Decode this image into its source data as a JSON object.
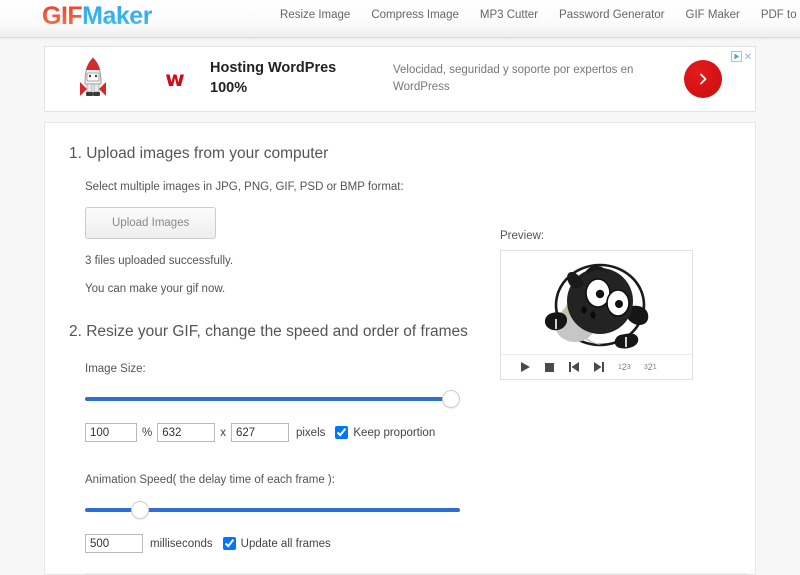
{
  "header": {
    "logo_gif": "GIF",
    "logo_maker": "Maker",
    "nav": [
      {
        "label": "Resize Image"
      },
      {
        "label": "Compress Image"
      },
      {
        "label": "MP3 Cutter"
      },
      {
        "label": "Password Generator"
      },
      {
        "label": "GIF Maker"
      },
      {
        "label": "PDF to JPG"
      }
    ]
  },
  "ad": {
    "brand_mark": "ᴡ",
    "headline": "Hosting WordPres 100%",
    "body": "Velocidad, seguridad y soporte por expertos en WordPress",
    "cta_icon": "chevron-right-icon",
    "adchoices_icon": "adchoices-triangle-icon",
    "close_label": "✕"
  },
  "step1": {
    "title": "1. Upload images from your computer",
    "instruction": "Select multiple images in JPG, PNG, GIF, PSD or BMP format:",
    "upload_button": "Upload Images",
    "status": "3 files uploaded successfully.",
    "hint": "You can make your gif now."
  },
  "step2": {
    "title": "2. Resize your GIF, change the speed and order of frames",
    "image_size_label": "Image Size:",
    "size_slider_percent": 100,
    "percent_value": "100",
    "percent_symbol": "%",
    "width_value": "632",
    "times_symbol": "x",
    "height_value": "627",
    "pixels_label": "pixels",
    "keep_proportion_label": "Keep proportion",
    "keep_proportion_checked": true,
    "speed_label": "Animation Speed( the delay time of each frame ):",
    "speed_slider_percent": 13,
    "milliseconds_value": "500",
    "milliseconds_label": "milliseconds",
    "update_all_frames_label": "Update all frames",
    "update_all_frames_checked": true
  },
  "preview": {
    "label": "Preview:",
    "image_alt": "sheep-cartoon-frame",
    "controls": [
      {
        "name": "play-button",
        "glyph": "▶"
      },
      {
        "name": "stop-button",
        "glyph": "■"
      },
      {
        "name": "previous-frame-button",
        "glyph": "⏮"
      },
      {
        "name": "next-frame-button",
        "glyph": "⏭"
      },
      {
        "name": "sort-ascending-button",
        "glyph": "123"
      },
      {
        "name": "sort-descending-button",
        "glyph": "321"
      }
    ]
  },
  "colors": {
    "logo_red": "#ef3b2c",
    "logo_blue": "#2fa8e8",
    "slider_blue": "#2e6fd4",
    "ad_red": "#d2091a",
    "page_bg": "#f7f7f7"
  }
}
